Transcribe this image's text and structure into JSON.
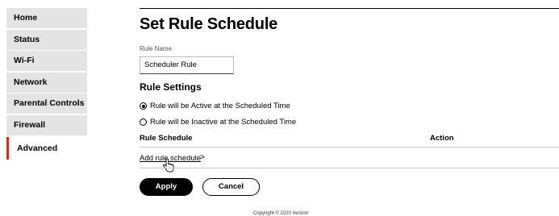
{
  "sidebar": {
    "items": [
      {
        "label": "Home"
      },
      {
        "label": "Status"
      },
      {
        "label": "Wi-Fi"
      },
      {
        "label": "Network"
      },
      {
        "label": "Parental Controls"
      },
      {
        "label": "Firewall"
      },
      {
        "label": "Advanced"
      }
    ],
    "accent_color": "#d52b1e"
  },
  "main": {
    "title": "Set Rule Schedule",
    "rule_name_label": "Rule Name",
    "rule_name_value": "Scheduler Rule",
    "section_title": "Rule Settings",
    "radio_active": "Rule will be Active at the Scheduled Time",
    "radio_inactive": "Rule will be Inactive at the Scheduled Time",
    "selected_option": "active",
    "table_headers": [
      "Rule Schedule",
      "Action"
    ],
    "add_link": "Add rule schedule",
    "add_chevron": ">",
    "apply_label": "Apply",
    "cancel_label": "Cancel"
  },
  "footer": {
    "text": "Copyright © 2020 Verizon"
  }
}
